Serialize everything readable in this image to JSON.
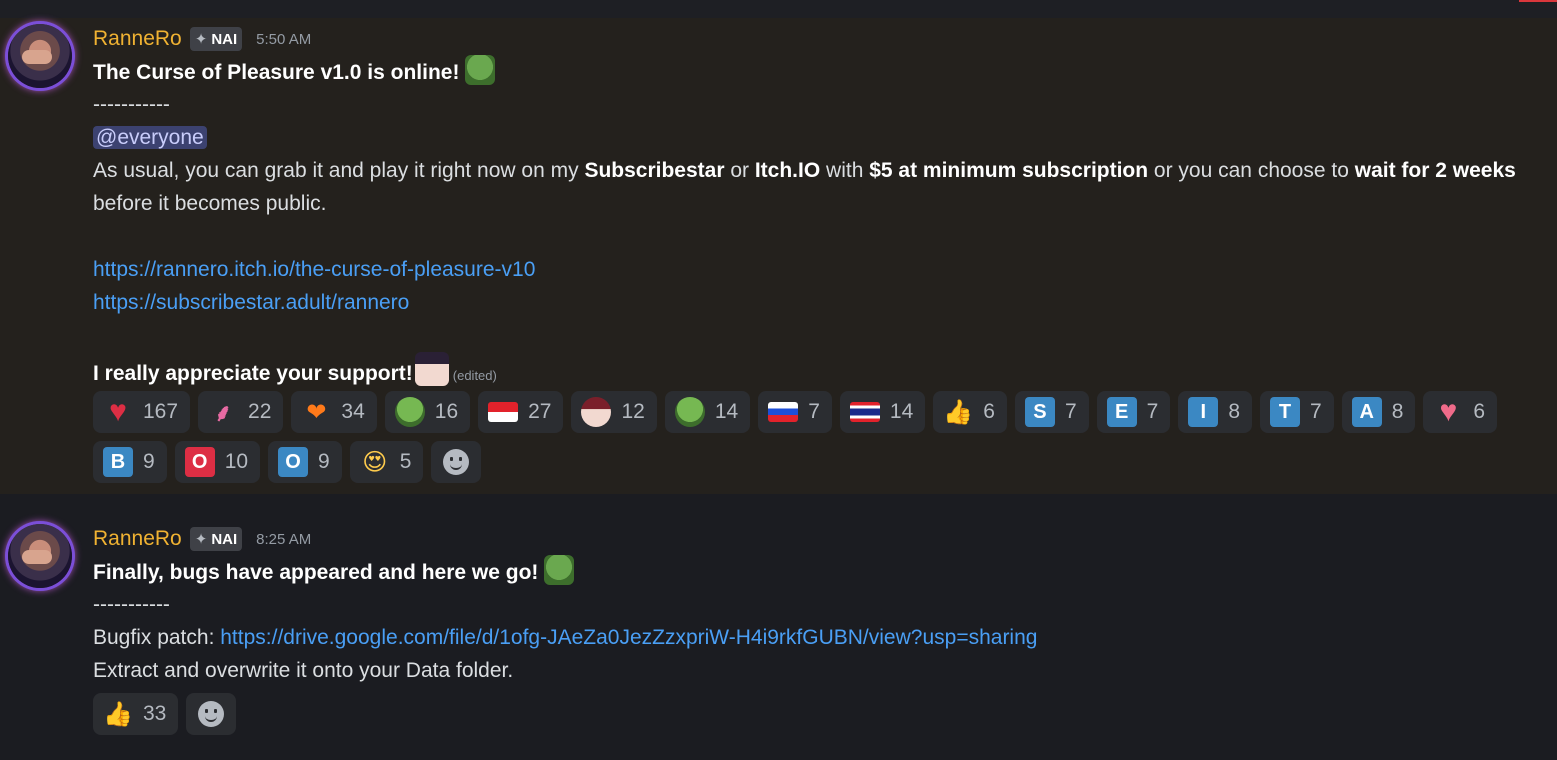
{
  "messages": [
    {
      "username": "RanneRo",
      "tag": "NAI",
      "tag_icon": "sparkle-icon",
      "time": "5:50 AM",
      "title": "The Curse of Pleasure v1.0 is online!",
      "divider": "-----------",
      "mention": "@everyone",
      "p1_a": "As usual, you can grab it and play it right now on my ",
      "p1_b": "Subscribestar",
      "p1_c": " or ",
      "p1_d": "Itch.IO",
      "p1_e": " with ",
      "p1_f": "$5 at minimum subscription",
      "p1_g": " or you can choose to ",
      "p1_h": "wait for 2 weeks",
      "p1_i": " before it becomes public.",
      "link1": "https://rannero.itch.io/the-curse-of-pleasure-v10",
      "link2": "https://subscribestar.adult/rannero",
      "thanks": "I really appreciate your support!",
      "edited": "(edited)",
      "reactions": [
        {
          "icon": "red-heart-icon",
          "count": "167"
        },
        {
          "icon": "pink-custom-emoji-icon",
          "count": "22"
        },
        {
          "icon": "heart-on-fire-icon",
          "count": "34"
        },
        {
          "icon": "pepe-emoji-icon",
          "count": "16"
        },
        {
          "icon": "indonesia-flag-icon",
          "count": "27"
        },
        {
          "icon": "anime-face-emoji-icon",
          "count": "12"
        },
        {
          "icon": "pepe-emoji-icon",
          "count": "14"
        },
        {
          "icon": "russia-flag-icon",
          "count": "7"
        },
        {
          "icon": "thailand-flag-icon",
          "count": "14"
        },
        {
          "icon": "thumbs-up-icon",
          "count": "6"
        },
        {
          "icon": "regional-s-icon",
          "letter": "S",
          "count": "7"
        },
        {
          "icon": "regional-e-icon",
          "letter": "E",
          "count": "7"
        },
        {
          "icon": "regional-i-icon",
          "letter": "I",
          "count": "8"
        },
        {
          "icon": "regional-t-icon",
          "letter": "T",
          "count": "7"
        },
        {
          "icon": "regional-a-icon",
          "letter": "A",
          "count": "8"
        },
        {
          "icon": "sparkling-heart-icon",
          "count": "6"
        },
        {
          "icon": "b-button-icon",
          "letter": "B",
          "count": "9"
        },
        {
          "icon": "o-button-red-icon",
          "letter": "O",
          "count": "10"
        },
        {
          "icon": "o-button-blue-icon",
          "letter": "O",
          "count": "9"
        },
        {
          "icon": "heart-eyes-icon",
          "count": "5"
        }
      ]
    },
    {
      "username": "RanneRo",
      "tag": "NAI",
      "tag_icon": "sparkle-icon",
      "time": "8:25 AM",
      "title": "Finally, bugs have appeared and here we go!",
      "divider": "-----------",
      "patch_label": "Bugfix patch: ",
      "patch_link": "https://drive.google.com/file/d/1ofg-JAeZa0JezZzxpriW-H4i9rkfGUBN/view?usp=sharing",
      "extract": "Extract and overwrite it onto your Data folder.",
      "reactions": [
        {
          "icon": "thumbs-up-icon",
          "count": "33"
        }
      ]
    }
  ]
}
